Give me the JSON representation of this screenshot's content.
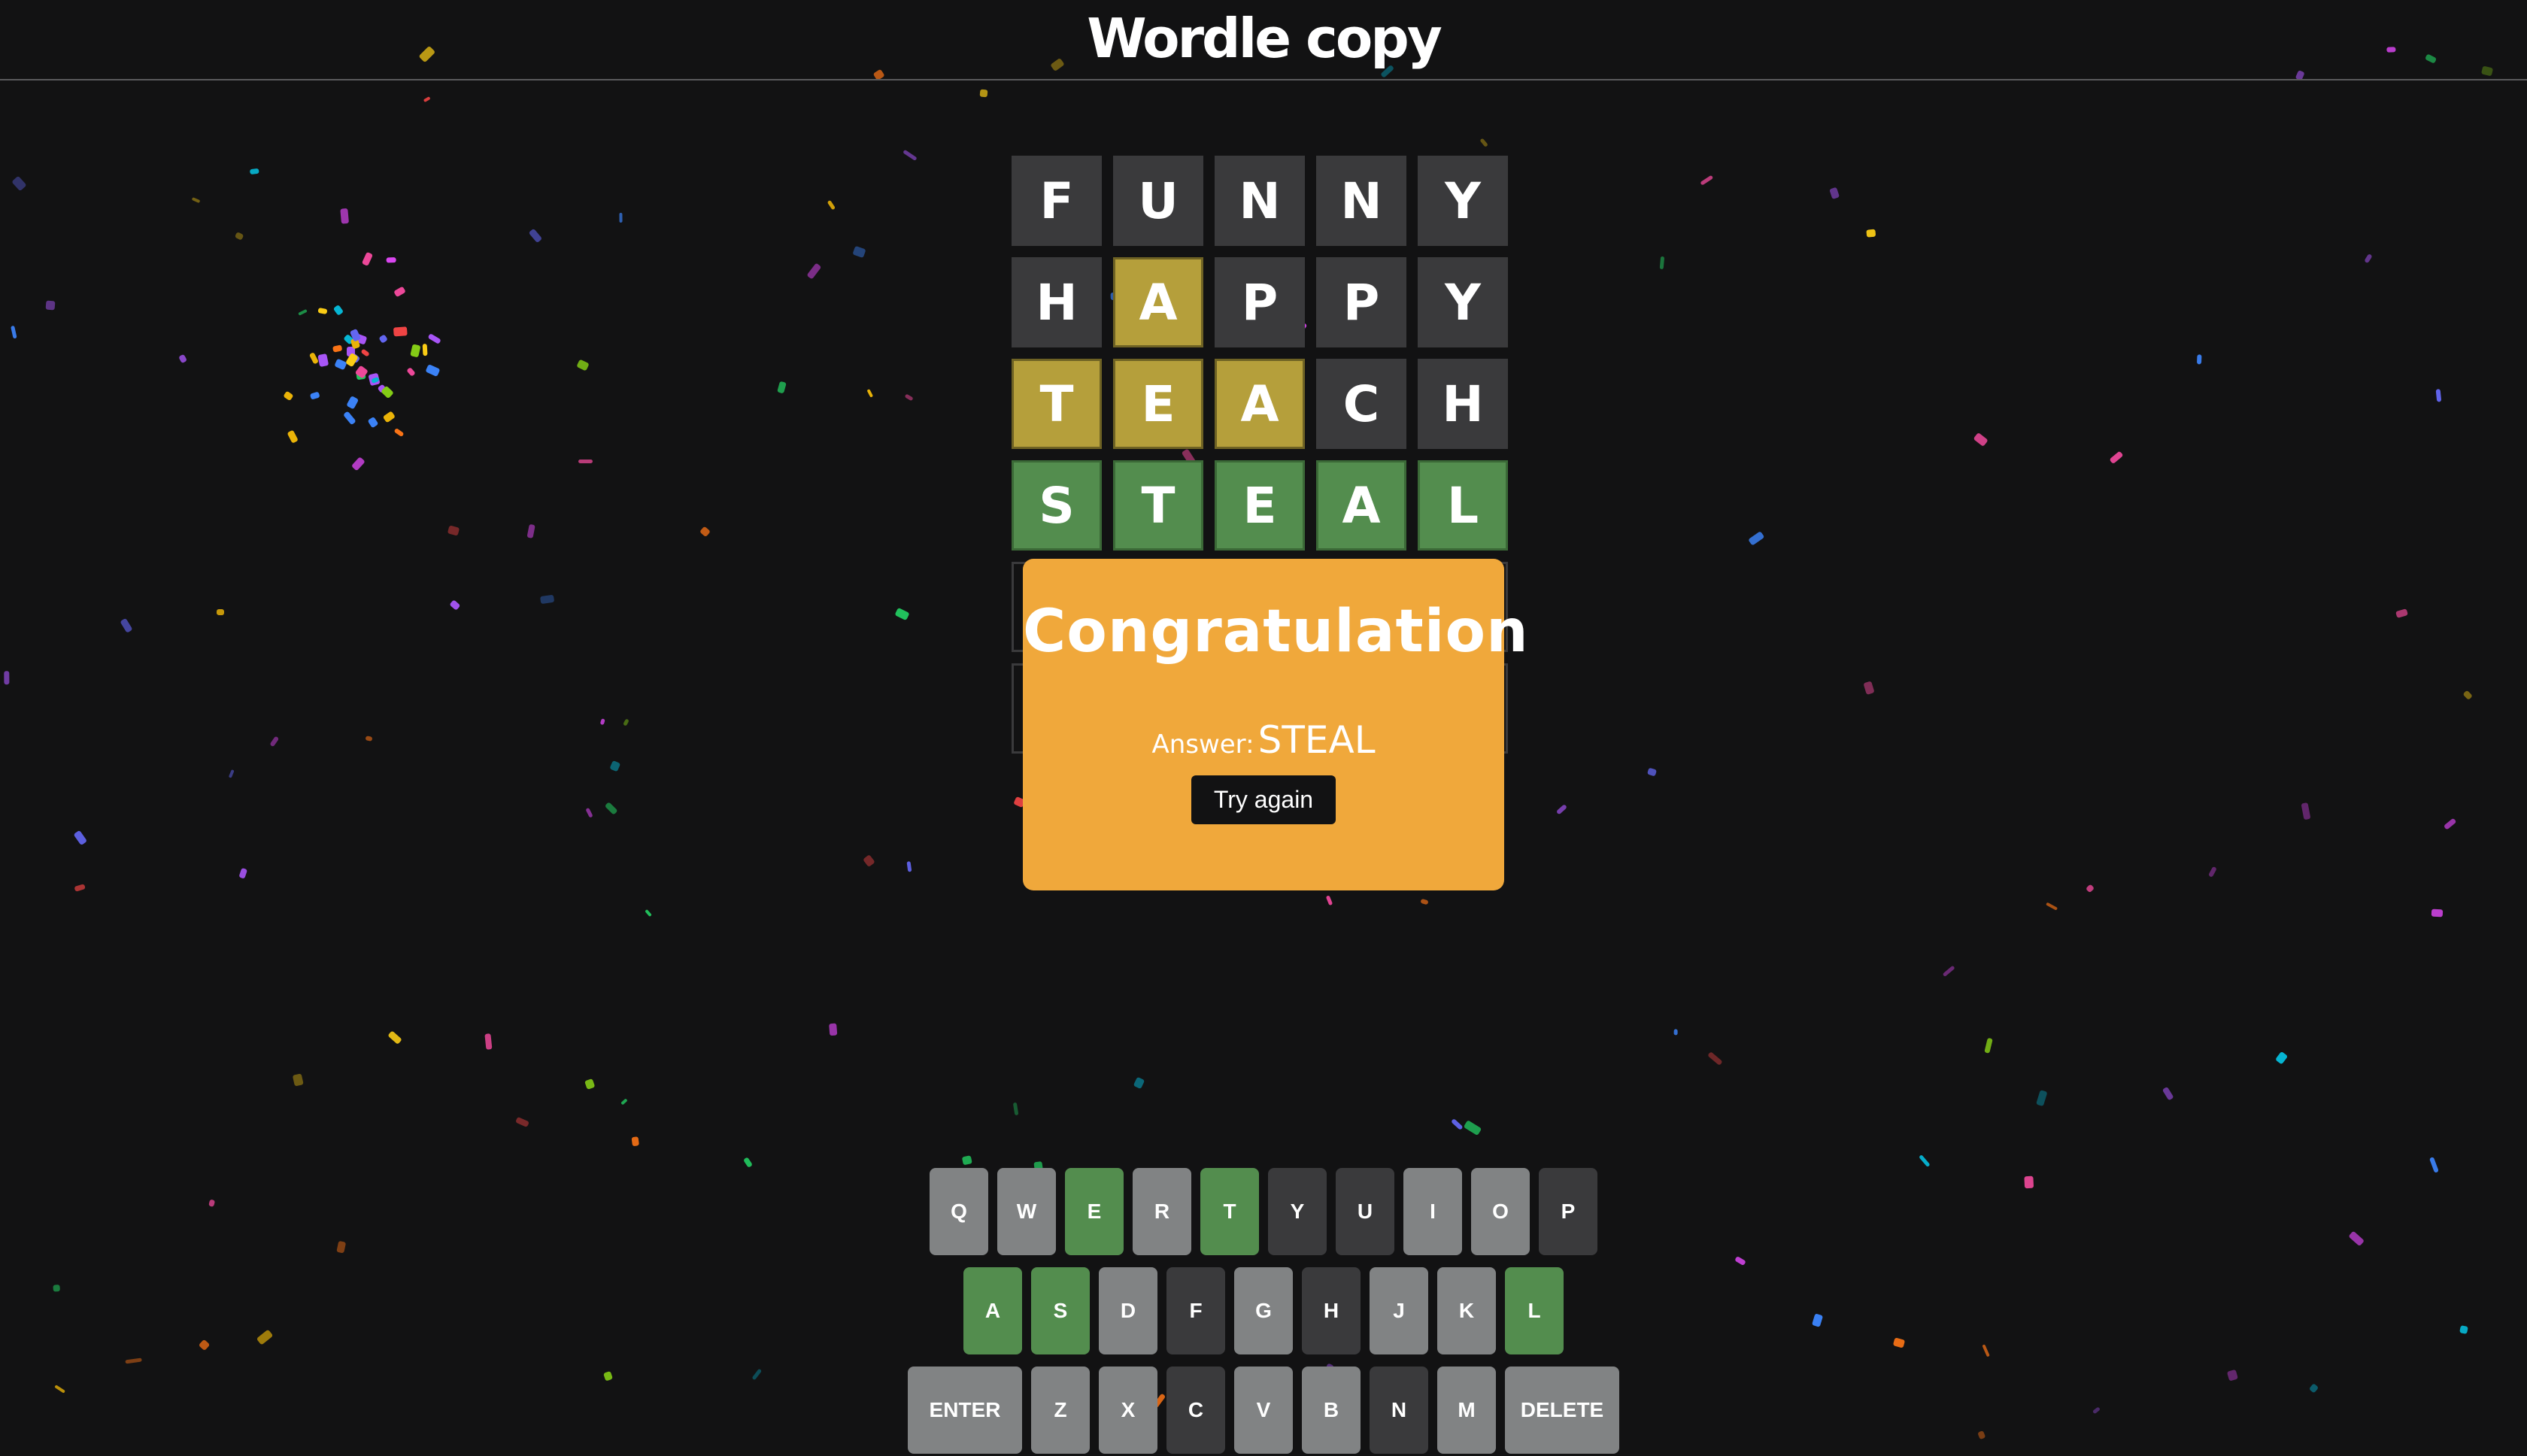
{
  "header": {
    "title": "Wordle copy"
  },
  "board": {
    "rows": [
      {
        "tiles": [
          {
            "letter": "F",
            "state": "absent"
          },
          {
            "letter": "U",
            "state": "absent"
          },
          {
            "letter": "N",
            "state": "absent"
          },
          {
            "letter": "N",
            "state": "absent"
          },
          {
            "letter": "Y",
            "state": "absent"
          }
        ]
      },
      {
        "tiles": [
          {
            "letter": "H",
            "state": "absent"
          },
          {
            "letter": "A",
            "state": "present"
          },
          {
            "letter": "P",
            "state": "absent"
          },
          {
            "letter": "P",
            "state": "absent"
          },
          {
            "letter": "Y",
            "state": "absent"
          }
        ]
      },
      {
        "tiles": [
          {
            "letter": "T",
            "state": "present"
          },
          {
            "letter": "E",
            "state": "present"
          },
          {
            "letter": "A",
            "state": "present"
          },
          {
            "letter": "C",
            "state": "absent"
          },
          {
            "letter": "H",
            "state": "absent"
          }
        ]
      },
      {
        "tiles": [
          {
            "letter": "S",
            "state": "correct"
          },
          {
            "letter": "T",
            "state": "correct"
          },
          {
            "letter": "E",
            "state": "correct"
          },
          {
            "letter": "A",
            "state": "correct"
          },
          {
            "letter": "L",
            "state": "correct"
          }
        ]
      },
      {
        "tiles": [
          {
            "letter": "",
            "state": "empty"
          },
          {
            "letter": "",
            "state": "empty"
          },
          {
            "letter": "",
            "state": "empty"
          },
          {
            "letter": "",
            "state": "empty"
          },
          {
            "letter": "",
            "state": "empty"
          }
        ]
      },
      {
        "tiles": [
          {
            "letter": "",
            "state": "empty"
          },
          {
            "letter": "",
            "state": "empty"
          },
          {
            "letter": "",
            "state": "empty"
          },
          {
            "letter": "",
            "state": "empty"
          },
          {
            "letter": "",
            "state": "empty"
          }
        ]
      }
    ]
  },
  "modal": {
    "title": "Congratulation",
    "answer_label": "Answer:",
    "answer_word": "STEAL",
    "button_label": "Try again"
  },
  "keyboard": {
    "rows": [
      [
        {
          "label": "Q",
          "state": "gray"
        },
        {
          "label": "W",
          "state": "gray"
        },
        {
          "label": "E",
          "state": "green"
        },
        {
          "label": "R",
          "state": "gray"
        },
        {
          "label": "T",
          "state": "green"
        },
        {
          "label": "Y",
          "state": "dark"
        },
        {
          "label": "U",
          "state": "dark"
        },
        {
          "label": "I",
          "state": "gray"
        },
        {
          "label": "O",
          "state": "gray"
        },
        {
          "label": "P",
          "state": "dark"
        }
      ],
      [
        {
          "label": "A",
          "state": "green"
        },
        {
          "label": "S",
          "state": "green"
        },
        {
          "label": "D",
          "state": "gray"
        },
        {
          "label": "F",
          "state": "dark"
        },
        {
          "label": "G",
          "state": "gray"
        },
        {
          "label": "H",
          "state": "dark"
        },
        {
          "label": "J",
          "state": "gray"
        },
        {
          "label": "K",
          "state": "gray"
        },
        {
          "label": "L",
          "state": "green"
        }
      ],
      [
        {
          "label": "ENTER",
          "state": "gray",
          "wide": true
        },
        {
          "label": "Z",
          "state": "gray"
        },
        {
          "label": "X",
          "state": "gray"
        },
        {
          "label": "C",
          "state": "dark"
        },
        {
          "label": "V",
          "state": "gray"
        },
        {
          "label": "B",
          "state": "gray"
        },
        {
          "label": "N",
          "state": "dark"
        },
        {
          "label": "M",
          "state": "gray"
        },
        {
          "label": "DELETE",
          "state": "gray",
          "wide": true
        }
      ]
    ]
  },
  "colors": {
    "background": "#121213",
    "absent": "#3a3a3c",
    "present": "#b59f3b",
    "correct": "#538d4e",
    "key_gray": "#818384",
    "modal": "#f0a83b"
  }
}
